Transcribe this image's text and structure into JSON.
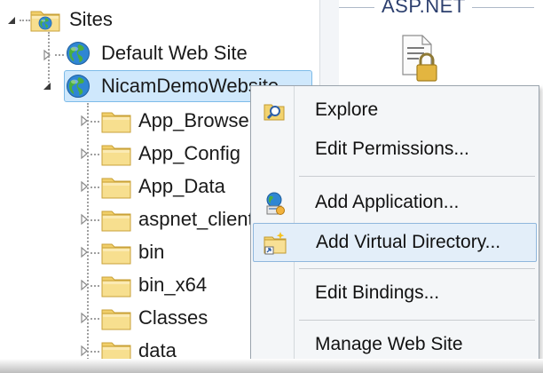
{
  "tree": {
    "root_label": "Sites",
    "sites": [
      {
        "label": "Default Web Site"
      },
      {
        "label": "NicamDemoWebsite"
      }
    ],
    "children": [
      {
        "label": "App_Browsers"
      },
      {
        "label": "App_Config"
      },
      {
        "label": "App_Data"
      },
      {
        "label": "aspnet_client"
      },
      {
        "label": "bin"
      },
      {
        "label": "bin_x64"
      },
      {
        "label": "Classes"
      },
      {
        "label": "data"
      }
    ]
  },
  "right_pane": {
    "group_title": "ASP.NET"
  },
  "context_menu": {
    "items": [
      {
        "label": "Explore",
        "icon": "explore-icon"
      },
      {
        "label": "Edit Permissions...",
        "icon": ""
      },
      {
        "label": "Add Application...",
        "icon": "add-application-icon"
      },
      {
        "label": "Add Virtual Directory...",
        "icon": "add-virtual-directory-icon"
      },
      {
        "label": "Edit Bindings...",
        "icon": ""
      },
      {
        "label": "Manage Web Site",
        "icon": ""
      }
    ],
    "highlighted_index": 3
  },
  "colors": {
    "selection_fill": "#cfe8fc",
    "selection_border": "#7dbbe8",
    "menu_bg": "#f4f6f8",
    "highlight_fill": "#e3eef9",
    "folder_yellow": "#f3d77b"
  }
}
